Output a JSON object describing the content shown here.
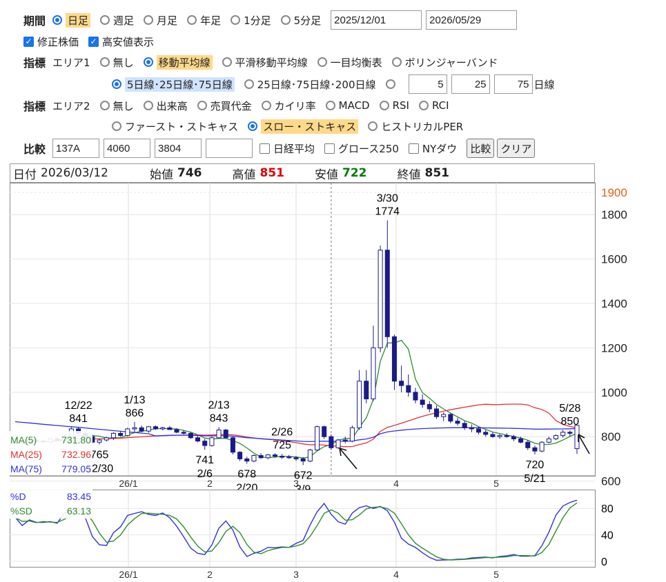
{
  "controls": {
    "period": {
      "label": "期間",
      "options": [
        "日足",
        "週足",
        "月足",
        "年足",
        "1分足",
        "5分足"
      ],
      "selected": 0,
      "start_date": "2025/12/01",
      "end_date": "2026/05/29"
    },
    "checks": [
      {
        "label": "修正株価",
        "checked": true
      },
      {
        "label": "高安値表示",
        "checked": true
      }
    ],
    "indicator1": {
      "label": "指標",
      "area": "エリア1",
      "options": [
        "無し",
        "移動平均線",
        "平滑移動平均線",
        "一目均衡表",
        "ボリンジャーバンド"
      ],
      "selected": 1,
      "ma_options": [
        "5日線･25日線･75日線",
        "25日線･75日線･200日線"
      ],
      "ma_selected": 0,
      "custom": [
        "5",
        "25",
        "75"
      ],
      "custom_suffix": "日線"
    },
    "indicator2": {
      "label": "指標",
      "area": "エリア2",
      "options": [
        "無し",
        "出来高",
        "売買代金",
        "カイリ率",
        "MACD",
        "RSI",
        "RCI"
      ],
      "options2": [
        "ファースト・ストキャス",
        "スロー・ストキャス",
        "ヒストリカルPER"
      ],
      "selected2": 1
    },
    "compare": {
      "label": "比較",
      "codes": [
        "137A",
        "4060",
        "3804",
        ""
      ],
      "checks": [
        "日経平均",
        "グロース250",
        "NYダウ"
      ],
      "buttons": [
        "比較",
        "クリア"
      ]
    }
  },
  "info": {
    "date_label": "日付",
    "date": "2026/03/12",
    "open_label": "始値",
    "open": "746",
    "high_label": "高値",
    "high": "851",
    "low_label": "安値",
    "low": "722",
    "close_label": "終値",
    "close": "851",
    "colors": {
      "high": "#e00000",
      "low": "#007a00"
    }
  },
  "chart_data": [
    {
      "type": "candlestick",
      "ylim": [
        600,
        1900
      ],
      "y_ticks": [
        "1900",
        "1800",
        "1600",
        "1400",
        "1200",
        "1000",
        "800",
        "600"
      ],
      "x_ticks": [
        "26/1",
        "2",
        "3",
        "4",
        "5"
      ],
      "legend": [
        {
          "name": "MA(5)",
          "value": "731.80",
          "color": "#2e8b2e"
        },
        {
          "name": "MA(25)",
          "value": "732.96",
          "color": "#e03030"
        },
        {
          "name": "MA(75)",
          "value": "779.05",
          "color": "#3030e0"
        }
      ],
      "annotations": [
        {
          "date": "12/22",
          "value": "841"
        },
        {
          "date": "1/13",
          "value": "866"
        },
        {
          "date": "12/30",
          "value": "765"
        },
        {
          "date": "2/6",
          "value": "741"
        },
        {
          "date": "2/13",
          "value": "843"
        },
        {
          "date": "2/20",
          "value": "678"
        },
        {
          "date": "2/26",
          "value": "725"
        },
        {
          "date": "3/9",
          "value": "672"
        },
        {
          "date": "3/30",
          "value": "1774"
        },
        {
          "date": "5/21",
          "value": "720"
        },
        {
          "date": "5/28",
          "value": "850"
        }
      ],
      "candles": [
        [
          770,
          780,
          765,
          775
        ],
        [
          775,
          782,
          768,
          772
        ],
        [
          772,
          790,
          770,
          785
        ],
        [
          785,
          792,
          775,
          780
        ],
        [
          780,
          788,
          772,
          776
        ],
        [
          776,
          795,
          770,
          790
        ],
        [
          790,
          800,
          780,
          782
        ],
        [
          782,
          805,
          778,
          800
        ],
        [
          800,
          842,
          795,
          835
        ],
        [
          835,
          841,
          810,
          815
        ],
        [
          815,
          820,
          795,
          800
        ],
        [
          800,
          810,
          770,
          775
        ],
        [
          775,
          790,
          765,
          785
        ],
        [
          785,
          800,
          778,
          795
        ],
        [
          795,
          820,
          785,
          815
        ],
        [
          815,
          825,
          800,
          805
        ],
        [
          805,
          840,
          800,
          835
        ],
        [
          835,
          866,
          820,
          840
        ],
        [
          840,
          850,
          820,
          825
        ],
        [
          825,
          848,
          818,
          845
        ],
        [
          845,
          850,
          830,
          835
        ],
        [
          835,
          845,
          828,
          840
        ],
        [
          840,
          848,
          830,
          832
        ],
        [
          832,
          838,
          815,
          820
        ],
        [
          820,
          830,
          810,
          815
        ],
        [
          815,
          820,
          790,
          795
        ],
        [
          795,
          805,
          775,
          780
        ],
        [
          780,
          790,
          741,
          760
        ],
        [
          760,
          800,
          755,
          795
        ],
        [
          795,
          843,
          790,
          830
        ],
        [
          830,
          835,
          790,
          795
        ],
        [
          795,
          800,
          720,
          730
        ],
        [
          730,
          735,
          690,
          700
        ],
        [
          700,
          710,
          678,
          690
        ],
        [
          690,
          720,
          685,
          715
        ],
        [
          715,
          725,
          700,
          705
        ],
        [
          705,
          722,
          698,
          718
        ],
        [
          718,
          725,
          705,
          712
        ],
        [
          712,
          722,
          700,
          710
        ],
        [
          710,
          718,
          700,
          705
        ],
        [
          705,
          712,
          690,
          700
        ],
        [
          700,
          708,
          672,
          690
        ],
        [
          690,
          745,
          685,
          740
        ],
        [
          740,
          850,
          735,
          845
        ],
        [
          845,
          850,
          790,
          800
        ],
        [
          800,
          810,
          740,
          750
        ],
        [
          750,
          790,
          745,
          785
        ],
        [
          785,
          800,
          770,
          780
        ],
        [
          780,
          850,
          775,
          840
        ],
        [
          840,
          1100,
          830,
          1050
        ],
        [
          1050,
          1100,
          950,
          970
        ],
        [
          970,
          1300,
          960,
          1200
        ],
        [
          1200,
          1660,
          1180,
          1640
        ],
        [
          1640,
          1774,
          1200,
          1250
        ],
        [
          1250,
          1260,
          1010,
          1050
        ],
        [
          1050,
          1120,
          1000,
          1030
        ],
        [
          1030,
          1080,
          980,
          1000
        ],
        [
          1000,
          1020,
          950,
          965
        ],
        [
          965,
          990,
          930,
          945
        ],
        [
          945,
          960,
          910,
          925
        ],
        [
          925,
          940,
          880,
          890
        ],
        [
          890,
          910,
          870,
          900
        ],
        [
          900,
          905,
          860,
          870
        ],
        [
          870,
          885,
          850,
          860
        ],
        [
          860,
          870,
          830,
          840
        ],
        [
          840,
          855,
          820,
          835
        ],
        [
          835,
          845,
          810,
          820
        ],
        [
          820,
          830,
          800,
          810
        ],
        [
          810,
          820,
          795,
          800
        ],
        [
          800,
          812,
          790,
          805
        ],
        [
          805,
          815,
          795,
          800
        ],
        [
          800,
          808,
          780,
          790
        ],
        [
          790,
          800,
          770,
          775
        ],
        [
          775,
          785,
          740,
          750
        ],
        [
          750,
          760,
          720,
          735
        ],
        [
          735,
          780,
          730,
          775
        ],
        [
          775,
          800,
          770,
          790
        ],
        [
          790,
          810,
          785,
          805
        ],
        [
          805,
          830,
          795,
          820
        ],
        [
          820,
          828,
          800,
          815
        ],
        [
          746,
          851,
          722,
          851
        ]
      ]
    },
    {
      "type": "line",
      "ylim": [
        0,
        100
      ],
      "y_ticks": [
        "80",
        "40",
        "0"
      ],
      "x_ticks": [
        "26/1",
        "2",
        "3",
        "4",
        "5"
      ],
      "legend": [
        {
          "name": "%D",
          "value": "83.45",
          "color": "#3030e0"
        },
        {
          "name": "%SD",
          "value": "63.13",
          "color": "#2e8b2e"
        }
      ]
    }
  ]
}
